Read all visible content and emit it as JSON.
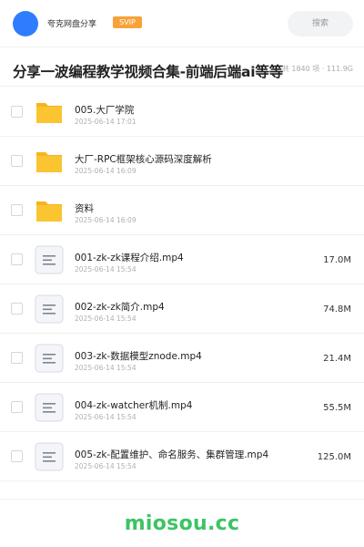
{
  "header": {
    "app_name": "夸克网盘分享",
    "badge": "SVIP",
    "search_label": "搜索",
    "avatar_color": "#2f7dff"
  },
  "share": {
    "title": "分享一波编程教学视频合集-前端后端ai等等",
    "meta": "共 1840 项 · 111.9G"
  },
  "files": [
    {
      "type": "folder",
      "icon": "folder-icon",
      "name": "005.大厂学院",
      "date": "2025-06-14 17:01",
      "size": ""
    },
    {
      "type": "folder",
      "icon": "folder-icon",
      "name": "大厂-RPC框架核心源码深度解析",
      "date": "2025-06-14 16:09",
      "size": ""
    },
    {
      "type": "folder",
      "icon": "folder-icon",
      "name": "资料",
      "date": "2025-06-14 16:09",
      "size": ""
    },
    {
      "type": "file",
      "icon": "document-icon",
      "name": "001-zk-zk课程介绍.mp4",
      "date": "2025-06-14 15:54",
      "size": "17.0M"
    },
    {
      "type": "file",
      "icon": "document-icon",
      "name": "002-zk-zk简介.mp4",
      "date": "2025-06-14 15:54",
      "size": "74.8M"
    },
    {
      "type": "file",
      "icon": "document-icon",
      "name": "003-zk-数据模型znode.mp4",
      "date": "2025-06-14 15:54",
      "size": "21.4M"
    },
    {
      "type": "file",
      "icon": "document-icon",
      "name": "004-zk-watcher机制.mp4",
      "date": "2025-06-14 15:54",
      "size": "55.5M"
    },
    {
      "type": "file",
      "icon": "document-icon",
      "name": "005-zk-配置维护、命名服务、集群管理.mp4",
      "date": "2025-06-14 15:54",
      "size": "125.0M"
    }
  ],
  "watermark": "miosou.cc",
  "colors": {
    "accent": "#2f7dff",
    "svip": "#f7a23b",
    "folder": "#fbc531",
    "watermark": "#3cc463"
  }
}
